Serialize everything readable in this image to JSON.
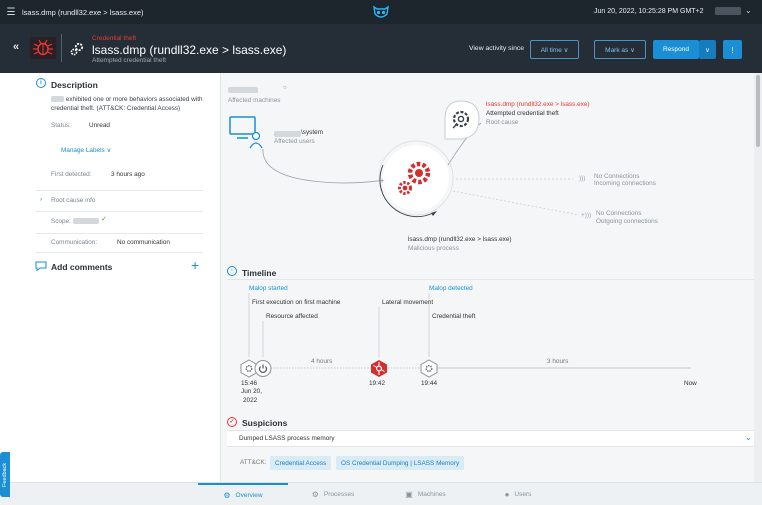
{
  "topbar": {
    "title": "lsass.dmp (rundll32.exe > lsass.exe)",
    "datetime": "Jun 20, 2022, 10:25:28 PM GMT+2"
  },
  "header": {
    "category": "Credential theft",
    "name": "lsass.dmp (rundll32.exe > lsass.exe)",
    "subtitle": "Attempted credential theft",
    "view_activity": "View activity since",
    "all_time": "All time ∨",
    "mark_as": "Mark as ∨",
    "respond": "Respond",
    "respond_chevron": "∨",
    "more": "⋮"
  },
  "description": {
    "title": "Description",
    "text_tail": "exhibited one or more behaviors associated with credential theft. (ATT&CK: Credential Access)",
    "status_label": "Status:",
    "status_value": "Unread",
    "manage_labels": "Manage Labels ∨",
    "first_detected_label": "First detected:",
    "first_detected_value": "3 hours ago",
    "root_cause_info": "Root cause info",
    "scope_label": "Scope:",
    "communication_label": "Communication:",
    "communication_value": "No communication",
    "add_comments": "Add comments",
    "add_plus": "+"
  },
  "graph": {
    "affected_machines": "Affected machines",
    "system_user": "\\system",
    "affected_users": "Affected users",
    "root_cause_name": "lsass.dmp (rundll32.exe > lsass.exe)",
    "root_cause_desc": "Attempted credential theft",
    "root_cause_label": "Root cause",
    "no_conn_in": "No Connections",
    "incoming": "Incoming connections",
    "no_conn_out": "No Connections",
    "outgoing": "Outgoing connections",
    "malicious_name": "lsass.dmp (rundll32.exe > lsass.exe)",
    "malicious_label": "Malicious process"
  },
  "timeline": {
    "title": "Timeline",
    "malop_started": "Malop started",
    "first_execution": "First execution on first machine",
    "resource_affected": "Resource affected",
    "lateral_movement": "Lateral movement",
    "malop_detected": "Malop detected",
    "credential_theft": "Credential theft",
    "gap1": "4 hours",
    "gap2": "3 hours",
    "t1_time": "15:46",
    "t1_date1": "Jun 20,",
    "t1_date2": "2022",
    "t2_time": "19:42",
    "t3_time": "19:44",
    "now": "Now"
  },
  "suspicions": {
    "title": "Suspicions",
    "item": "Dumped LSASS process memory",
    "attck_label": "ATT&CK:",
    "chip1": "Credential Access",
    "chip2": "OS Credential Dumping | LSASS Memory"
  },
  "tabs": {
    "overview": "Overview",
    "processes": "Processes",
    "machines": "Machines",
    "users": "Users"
  },
  "feedback": "Feedback",
  "colors": {
    "accent": "#1a8fd6",
    "danger": "#e53935",
    "header_bg": "#252e36",
    "topbar_bg": "#1d252d"
  }
}
